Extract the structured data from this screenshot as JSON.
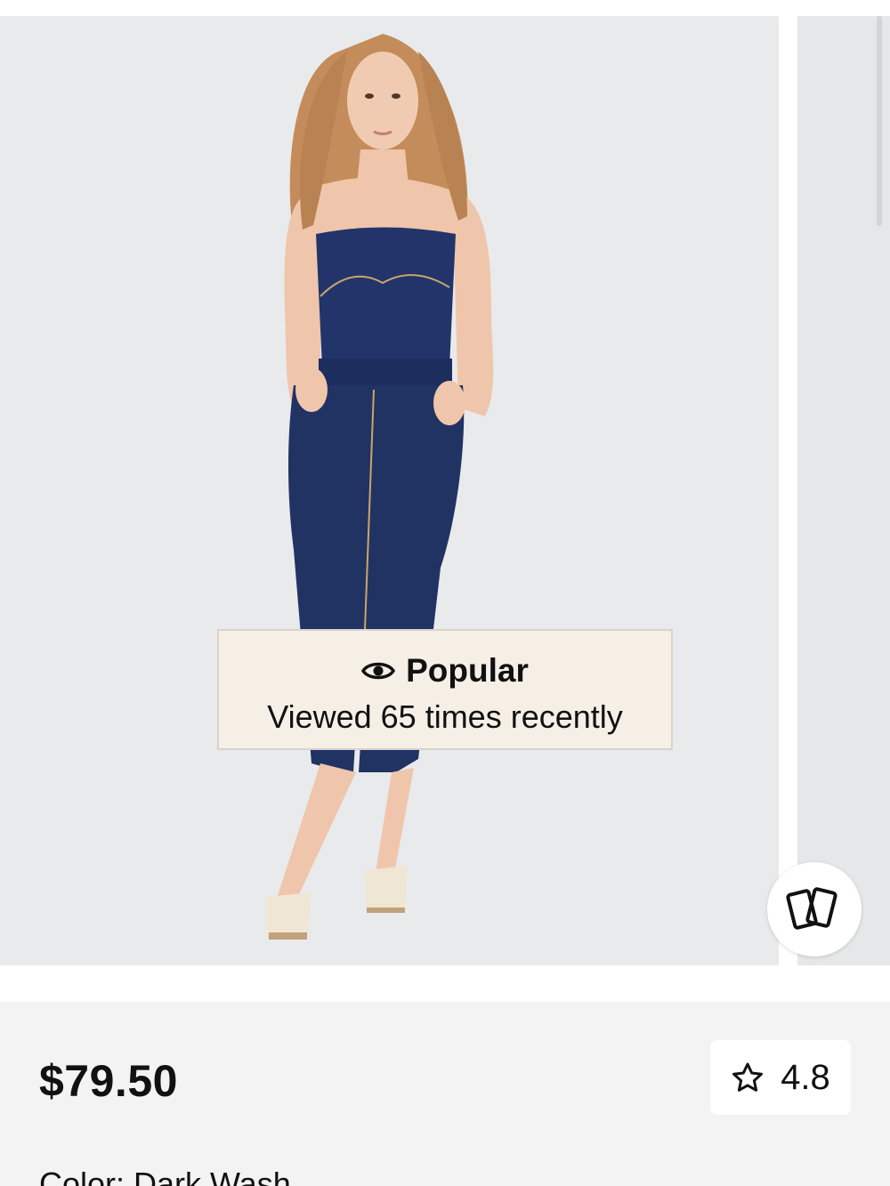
{
  "badge": {
    "icon": "eye-icon",
    "title": "Popular",
    "subtitle": "Viewed 65 times recently"
  },
  "compare_button": {
    "icon": "cards-icon"
  },
  "product": {
    "price": "$79.50",
    "rating": "4.8",
    "rating_icon": "star-outline-icon",
    "color_label": "Color:",
    "color_value": "Dark Wash"
  },
  "colors": {
    "photo_background": "#e9eaec",
    "badge_background": "#f5efe6",
    "info_background": "#f3f3f3",
    "denim": "#1f2f5a"
  }
}
